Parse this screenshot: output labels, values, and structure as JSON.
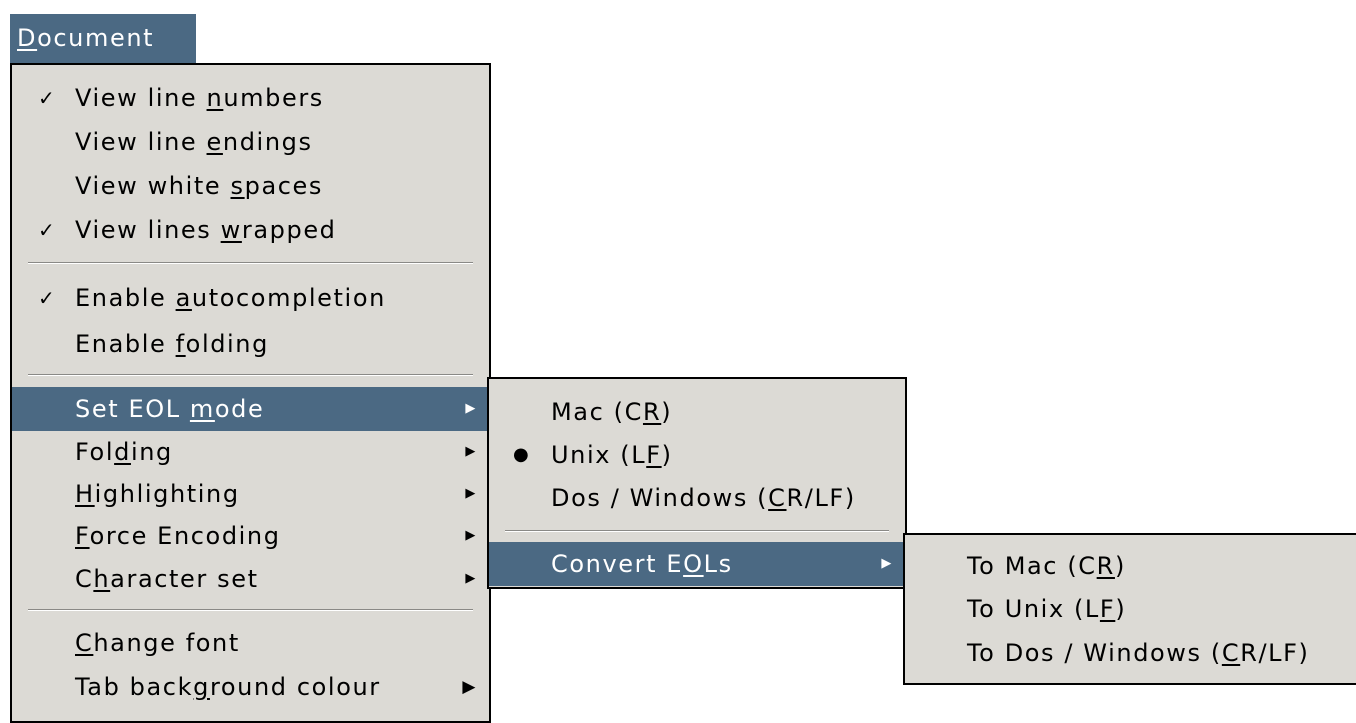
{
  "menubar": {
    "pre": "",
    "u": "D",
    "post": "ocument"
  },
  "main_menu": [
    {
      "id": "view-line-numbers",
      "mark": "✓",
      "pre": "View line ",
      "u": "n",
      "post": "umbers"
    },
    {
      "id": "view-line-endings",
      "mark": "",
      "pre": "View line ",
      "u": "e",
      "post": "ndings"
    },
    {
      "id": "view-white-spaces",
      "mark": "",
      "pre": "View white ",
      "u": "s",
      "post": "paces"
    },
    {
      "id": "view-lines-wrapped",
      "mark": "✓",
      "pre": "View lines ",
      "u": "w",
      "post": "rapped"
    },
    {
      "id": "enable-autocompletion",
      "mark": "✓",
      "pre": "Enable ",
      "u": "a",
      "post": "utocompletion"
    },
    {
      "id": "enable-folding",
      "mark": "",
      "pre": "Enable ",
      "u": "f",
      "post": "olding"
    },
    {
      "id": "set-eol-mode",
      "mark": "",
      "pre": "Set EOL ",
      "u": "m",
      "post": "ode",
      "arrow": "▶"
    },
    {
      "id": "folding",
      "mark": "",
      "pre": "Fol",
      "u": "d",
      "post": "ing",
      "arrow": "▶"
    },
    {
      "id": "highlighting",
      "mark": "",
      "pre": "",
      "u": "H",
      "post": "ighlighting",
      "arrow": "▶"
    },
    {
      "id": "force-encoding",
      "mark": "",
      "pre": "",
      "u": "F",
      "post": "orce Encoding",
      "arrow": "▶"
    },
    {
      "id": "character-set",
      "mark": "",
      "pre": "C",
      "u": "h",
      "post": "aracter set",
      "arrow": "▶"
    },
    {
      "id": "change-font",
      "mark": "",
      "pre": "",
      "u": "C",
      "post": "hange font"
    },
    {
      "id": "tab-background-colour",
      "mark": "",
      "pre": "Tab back",
      "u": "g",
      "post": "round colour",
      "arrow": "▶"
    }
  ],
  "eol_menu": [
    {
      "id": "mac-cr",
      "mark": "",
      "pre": "Mac (C",
      "u": "R",
      "post": ")"
    },
    {
      "id": "unix-lf",
      "mark": "●",
      "pre": "Unix (L",
      "u": "F",
      "post": ")"
    },
    {
      "id": "dos-windows",
      "mark": "",
      "pre": "Dos / Windows (",
      "u": "C",
      "post": "R/LF)"
    },
    {
      "id": "convert-eols",
      "mark": "",
      "pre": "Convert E",
      "u": "O",
      "post": "Ls",
      "arrow": "▶"
    }
  ],
  "convert_menu": [
    {
      "id": "to-mac-cr",
      "pre": "To Mac (C",
      "u": "R",
      "post": ")"
    },
    {
      "id": "to-unix-lf",
      "pre": "To Unix (L",
      "u": "F",
      "post": ")"
    },
    {
      "id": "to-dos-windows",
      "pre": "To Dos / Windows (",
      "u": "C",
      "post": "R/LF)"
    }
  ]
}
